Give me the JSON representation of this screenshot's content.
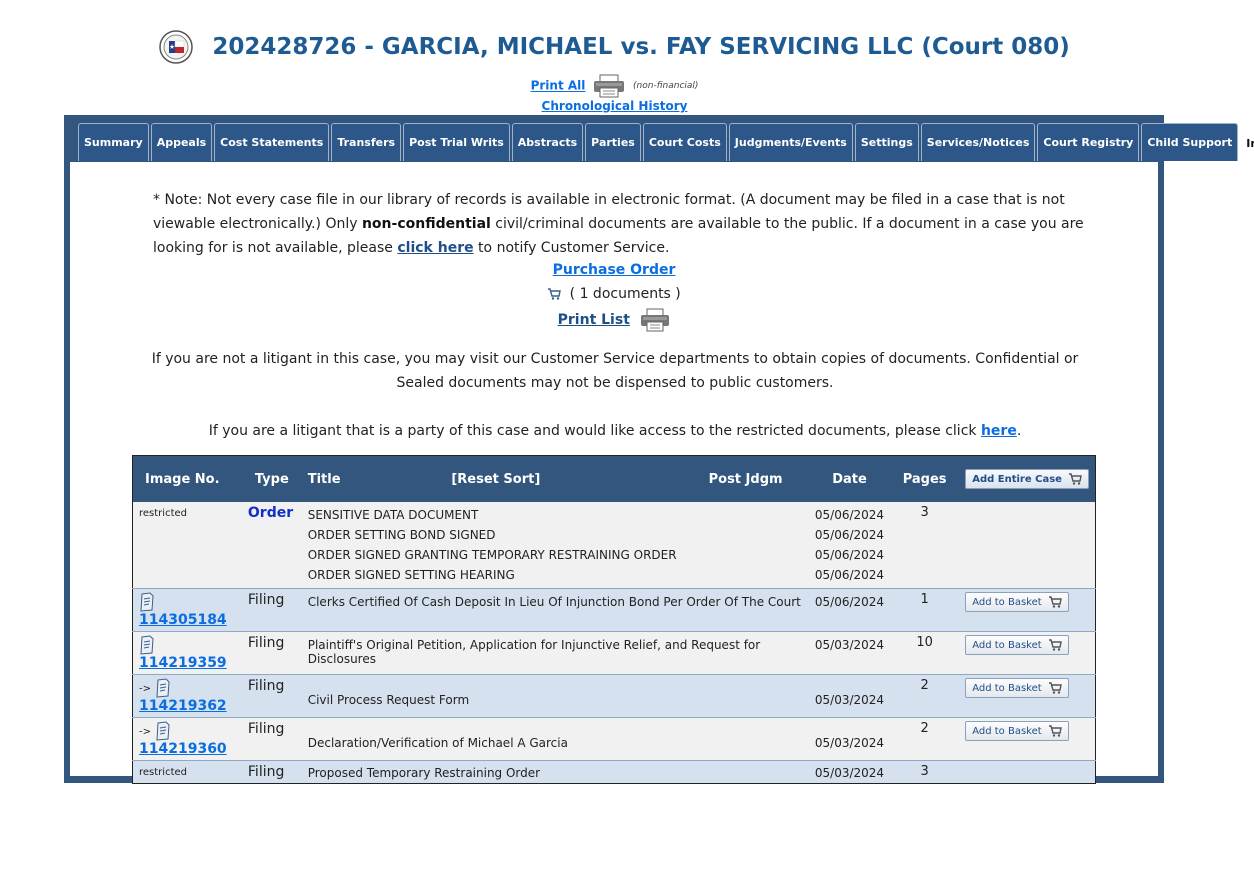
{
  "case": {
    "title": "202428726 - GARCIA, MICHAEL vs. FAY SERVICING LLC (Court 080)",
    "print_all": "Print All",
    "non_financial": "(non-financial)",
    "chrono_history": "Chronological History"
  },
  "tabs": [
    {
      "label": "Summary"
    },
    {
      "label": "Appeals"
    },
    {
      "label": "Cost Statements"
    },
    {
      "label": "Transfers"
    },
    {
      "label": "Post Trial Writs"
    },
    {
      "label": "Abstracts"
    },
    {
      "label": "Parties"
    },
    {
      "label": "Court Costs"
    },
    {
      "label": "Judgments/Events"
    },
    {
      "label": "Settings"
    },
    {
      "label": "Services/Notices"
    },
    {
      "label": "Court Registry"
    },
    {
      "label": "Child Support"
    },
    {
      "label": "Images"
    }
  ],
  "note": {
    "part1": "* Note: Not every case file in our library of records is available in electronic format. (A document may be filed in a case that is not viewable electronically.) Only ",
    "bold": "non-confidential",
    "part2": " civil/criminal documents are available to the public. If a document in a case you are looking for is not available, please ",
    "link": "click here",
    "part3": " to notify Customer Service."
  },
  "purchase_order": "Purchase Order",
  "documents_count": "( 1 documents )",
  "print_list": "Print List",
  "visit_para": "If you are not a litigant in this case, you may visit our Customer Service departments to obtain copies of documents. Confidential or Sealed documents may not be dispensed to public customers.",
  "litigant": {
    "text": "If you are a litigant that is a party of this case and would like access to the restricted documents, please click ",
    "link": "here",
    "end": "."
  },
  "table": {
    "headers": {
      "image_no": "Image No.",
      "type": "Type",
      "title": "Title",
      "reset_sort": "[Reset Sort]",
      "post_jdgm": "Post Jdgm",
      "date": "Date",
      "pages": "Pages",
      "add_entire": "Add Entire Case"
    },
    "add_basket": "Add to Basket",
    "restricted": "restricted",
    "arrow": "->",
    "order_group": {
      "type": "Order",
      "pages": "3",
      "items": [
        {
          "title": "SENSITIVE DATA DOCUMENT",
          "date": "05/06/2024"
        },
        {
          "title": "ORDER SETTING BOND SIGNED",
          "date": "05/06/2024"
        },
        {
          "title": "ORDER SIGNED GRANTING TEMPORARY RESTRAINING ORDER",
          "date": "05/06/2024"
        },
        {
          "title": "ORDER SIGNED SETTING HEARING",
          "date": "05/06/2024"
        }
      ]
    },
    "rows": [
      {
        "image": "114305184",
        "type": "Filing",
        "title": "Clerks Certified Of Cash Deposit In Lieu Of Injunction Bond Per Order Of The Court",
        "date": "05/06/2024",
        "pages": "1"
      },
      {
        "image": "114219359",
        "type": "Filing",
        "title": "Plaintiff's Original Petition, Application for Injunctive Relief, and Request for Disclosures",
        "date": "05/03/2024",
        "pages": "10"
      },
      {
        "image": "114219362",
        "type": "Filing",
        "title": "Civil Process Request Form",
        "date": "05/03/2024",
        "pages": "2"
      },
      {
        "image": "114219360",
        "type": "Filing",
        "title": "Declaration/Verification of Michael A Garcia",
        "date": "05/03/2024",
        "pages": "2"
      },
      {
        "type": "Filing",
        "title": "Proposed Temporary Restraining Order",
        "date": "05/03/2024",
        "pages": "3"
      }
    ]
  }
}
